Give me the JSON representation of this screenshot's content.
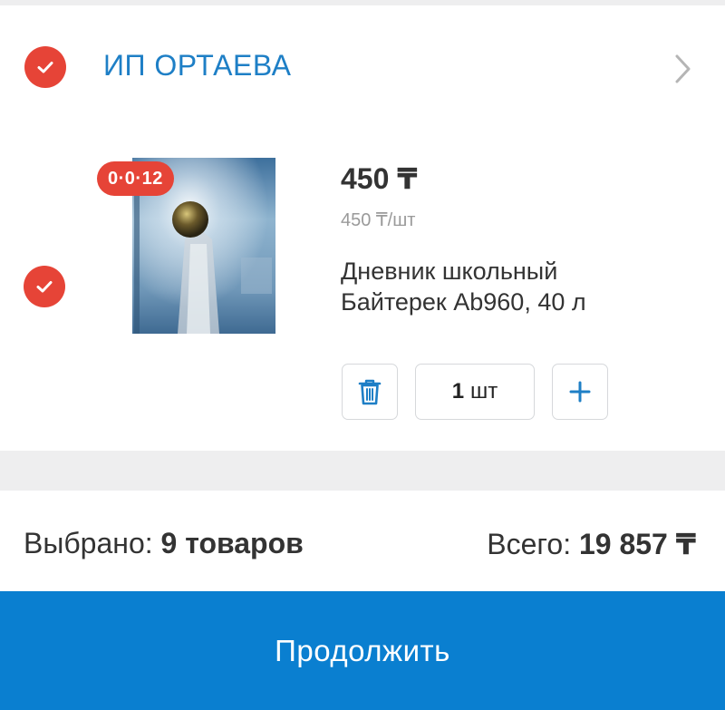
{
  "seller": {
    "name": "ИП ОРТАЕВА",
    "checked": true
  },
  "item": {
    "checked": true,
    "timer_badge": "0·0·12",
    "price": "450 ₸",
    "unit_price": "450 ₸/шт",
    "name_line1": "Дневник школьный",
    "name_line2": "Байтерек Ab960, 40 л",
    "quantity_value": "1",
    "quantity_unit": "шт"
  },
  "summary": {
    "selected_label": "Выбрано:",
    "selected_value": "9 товаров",
    "total_label": "Всего:",
    "total_value": "19 857 ₸"
  },
  "continue_button": {
    "label": "Продолжить"
  },
  "colors": {
    "accent_blue": "#1e7fc6",
    "button_blue": "#0a7fd0",
    "check_red": "#e64437",
    "background_gray": "#eeeeef"
  },
  "icons": {
    "seller_check": "check-circle-icon",
    "item_check": "check-circle-icon",
    "chevron": "chevron-right-icon",
    "delete": "trash-icon",
    "plus": "plus-icon"
  }
}
